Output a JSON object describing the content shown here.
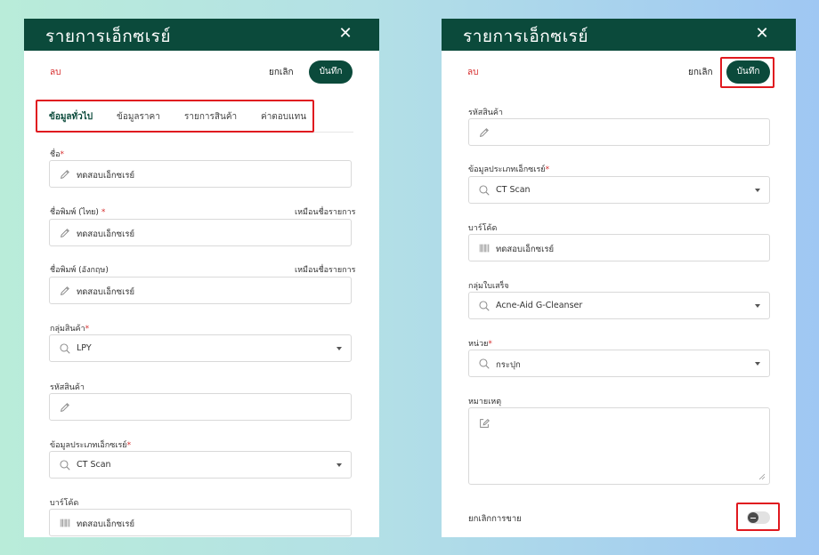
{
  "left_panel": {
    "header": {
      "title": "รายการเอ็กซเรย์",
      "close_glyph": "✕"
    },
    "actions": {
      "delete_label": "ลบ",
      "cancel_label": "ยกเลิก",
      "save_label": "บันทึก"
    },
    "tabs": [
      {
        "label": "ข้อมูลทั่วไป",
        "active": true
      },
      {
        "label": "ข้อมูลราคา",
        "active": false
      },
      {
        "label": "รายการสินค้า",
        "active": false
      },
      {
        "label": "ค่าตอบแทน",
        "active": false
      }
    ],
    "fields": {
      "name": {
        "label": "ชื่อ",
        "required_mark": "*",
        "value": "ทดสอบเอ็กซเรย์",
        "icon": "pencil-icon"
      },
      "print_name_th": {
        "label": "ชื่อพิมพ์ (ไทย)",
        "required_mark": "*",
        "right_label": "เหมือนชื่อรายการ",
        "value": "ทดสอบเอ็กซเรย์",
        "icon": "pencil-icon"
      },
      "print_name_en": {
        "label": "ชื่อพิมพ์ (อังกฤษ)",
        "right_label": "เหมือนชื่อรายการ",
        "value": "ทดสอบเอ็กซเรย์",
        "icon": "pencil-icon"
      },
      "product_group": {
        "label": "กลุ่มสินค้า",
        "required_mark": "*",
        "value": "LPY",
        "icon": "search-icon"
      },
      "product_code": {
        "label": "รหัสสินค้า",
        "value": "",
        "icon": "pencil-icon"
      },
      "xray_type": {
        "label": "ข้อมูลประเภทเอ็กซเรย์",
        "required_mark": "*",
        "value": "CT Scan",
        "icon": "search-icon"
      },
      "barcode": {
        "label": "บาร์โค้ด",
        "value": "ทดสอบเอ็กซเรย์",
        "icon": "barcode-icon"
      }
    }
  },
  "right_panel": {
    "header": {
      "title": "รายการเอ็กซเรย์",
      "close_glyph": "✕"
    },
    "actions": {
      "delete_label": "ลบ",
      "cancel_label": "ยกเลิก",
      "save_label": "บันทึก"
    },
    "fields": {
      "product_code": {
        "label": "รหัสสินค้า",
        "value": "",
        "icon": "pencil-icon"
      },
      "xray_type": {
        "label": "ข้อมูลประเภทเอ็กซเรย์",
        "required_mark": "*",
        "value": "CT Scan",
        "icon": "search-icon"
      },
      "barcode": {
        "label": "บาร์โค้ด",
        "value": "ทดสอบเอ็กซเรย์",
        "icon": "barcode-icon"
      },
      "receipt_group": {
        "label": "กลุ่มใบเสร็จ",
        "value": "Acne-Aid G-Cleanser",
        "icon": "search-icon"
      },
      "unit": {
        "label": "หน่วย",
        "required_mark": "*",
        "value": "กระปุก",
        "icon": "search-icon"
      },
      "note": {
        "label": "หมายเหตุ",
        "value": "",
        "icon": "edit-note-icon"
      },
      "cancel_sale": {
        "label": "ยกเลิกการขาย",
        "enabled": false
      }
    }
  },
  "colors": {
    "brand": "#0b4a3b",
    "danger": "#d62e2e",
    "highlight_box": "#e0191f"
  }
}
